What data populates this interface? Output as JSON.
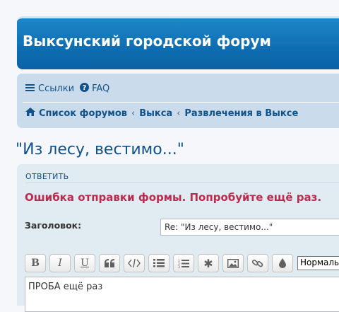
{
  "site": {
    "title": "Выксунский городской форум"
  },
  "nav": {
    "links_label": "Ссылки",
    "faq_label": "FAQ",
    "breadcrumbs": [
      "Список форумов",
      "Выкса",
      "Развлечения в Выксе"
    ],
    "crumb_separator": "‹"
  },
  "topic": {
    "title": "\"Из лесу, вестимо...\""
  },
  "post": {
    "reply_label": "ОТВЕТИТЬ",
    "error": "Ошибка отправки формы. Попробуйте ещё раз.",
    "subject_label": "Заголовок:",
    "subject_value": "Re: \"Из лесу, вестимо...\"",
    "font_size_selected": "Нормальный",
    "message": "ПРОБА ещё раз"
  },
  "toolbar": {
    "buttons": [
      {
        "icon": "bold-icon",
        "glyph": "B"
      },
      {
        "icon": "italic-icon",
        "glyph": "I"
      },
      {
        "icon": "underline-icon",
        "glyph": "U"
      },
      {
        "icon": "quote-icon",
        "glyph": "❝"
      },
      {
        "icon": "code-icon",
        "glyph": "</>"
      },
      {
        "icon": "list-icon",
        "glyph": "≡"
      },
      {
        "icon": "numbered-list-icon",
        "glyph": "1≡"
      },
      {
        "icon": "asterisk-icon",
        "glyph": "✱"
      },
      {
        "icon": "image-icon",
        "glyph": "▣"
      },
      {
        "icon": "link-icon",
        "glyph": "∞"
      },
      {
        "icon": "color-icon",
        "glyph": "💧"
      }
    ]
  },
  "colors": {
    "header": "#0e6db1",
    "link": "#105289",
    "error": "#bc2a4d",
    "panel": "#e1ebf2",
    "navbar": "#cadceb"
  }
}
